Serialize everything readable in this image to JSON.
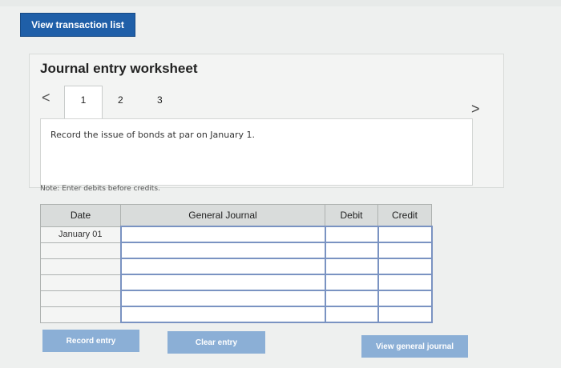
{
  "top_button": {
    "label": "View transaction list"
  },
  "worksheet": {
    "title": "Journal entry worksheet",
    "nav": {
      "prev": "<",
      "next": ">"
    },
    "tabs": [
      {
        "label": "1"
      },
      {
        "label": "2"
      },
      {
        "label": "3"
      }
    ],
    "instruction": "Record the issue of bonds at par on January 1.",
    "note": "Note: Enter debits before credits."
  },
  "table": {
    "headers": {
      "date": "Date",
      "journal": "General Journal",
      "debit": "Debit",
      "credit": "Credit"
    },
    "rows": [
      {
        "date": "January 01",
        "account": "",
        "debit": "",
        "credit": ""
      },
      {
        "date": "",
        "account": "",
        "debit": "",
        "credit": ""
      },
      {
        "date": "",
        "account": "",
        "debit": "",
        "credit": ""
      },
      {
        "date": "",
        "account": "",
        "debit": "",
        "credit": ""
      },
      {
        "date": "",
        "account": "",
        "debit": "",
        "credit": ""
      },
      {
        "date": "",
        "account": "",
        "debit": "",
        "credit": ""
      }
    ]
  },
  "buttons": {
    "record": "Record entry",
    "clear": "Clear entry",
    "view_journal": "View general journal"
  },
  "colors": {
    "primary_button": "#1f5fa8",
    "secondary_button": "#8bafd6",
    "header_bg": "#d9dcdb"
  }
}
